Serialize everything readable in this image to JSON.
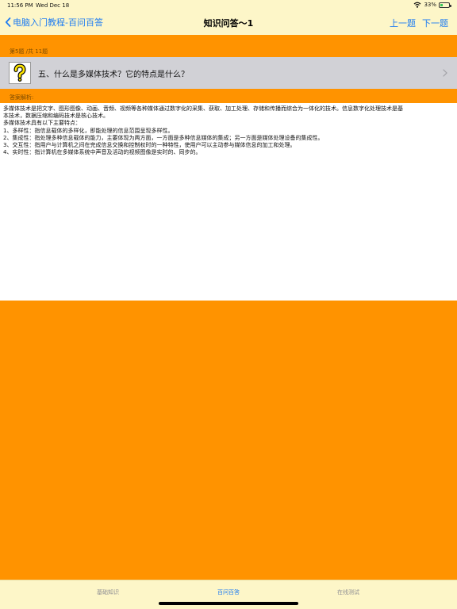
{
  "status_bar": {
    "time": "11:56 PM",
    "date": "Wed Dec 18",
    "battery_percent": "33%",
    "battery_level": 0.33
  },
  "nav": {
    "back_label": "电脑入门教程-百问百答",
    "title": "知识问答～1",
    "prev_label": "上一题",
    "next_label": "下一题"
  },
  "question": {
    "counter": "第5题 /共 11题",
    "text": "五、什么是多媒体技术？它的特点是什么？",
    "icon": "question-mark-icon"
  },
  "answer": {
    "header": "答案解析:",
    "lines": [
      "多媒体技术是把文字、图形图像、动画、音频、视频等各种媒体通过数字化的采集、获取、加工处理、存储和传播而综合为一体化的技术。信息数字化处理技术是基",
      "本技术，数据压缩和编码技术是核心技术。",
      "多媒体技术具有以下主要特点：",
      "1、多样性：指信息载体的多样化，即能处理的信息范围呈现多样性。",
      "2、集成性：指处理多种信息载体的能力，主要体现为两方面，一方面是多种信息媒体的集成；另一方面是媒体处理设备的集成性。",
      "3、交互性：指用户与计算机之间在完成信息交换和控制权时的一种特性，使用户可以主动参与媒体信息的加工和处理。",
      "4、实时性：指计算机在多媒体系统中声音及活动的视频图像是实时的、同步的。"
    ]
  },
  "tabs": [
    {
      "label": "基础知识",
      "active": false
    },
    {
      "label": "百问百答",
      "active": true
    },
    {
      "label": "在线测试",
      "active": false
    }
  ],
  "colors": {
    "accent": "#1E7CF2",
    "background": "#FF9300",
    "bar": "#FDF6C8"
  }
}
